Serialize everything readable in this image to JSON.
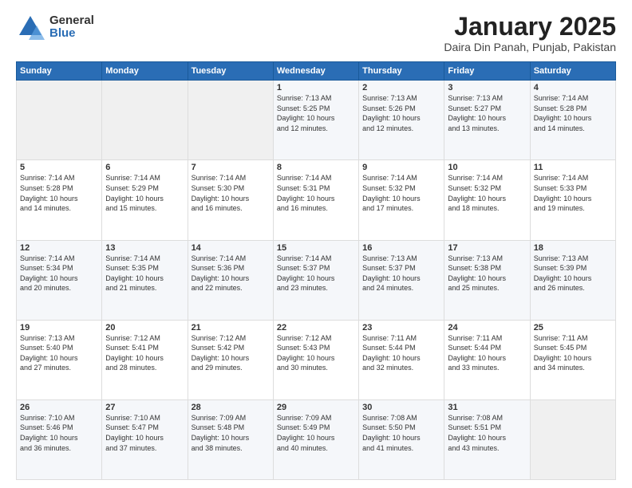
{
  "header": {
    "logo_general": "General",
    "logo_blue": "Blue",
    "month_title": "January 2025",
    "location": "Daira Din Panah, Punjab, Pakistan"
  },
  "weekdays": [
    "Sunday",
    "Monday",
    "Tuesday",
    "Wednesday",
    "Thursday",
    "Friday",
    "Saturday"
  ],
  "weeks": [
    [
      {
        "day": "",
        "info": ""
      },
      {
        "day": "",
        "info": ""
      },
      {
        "day": "",
        "info": ""
      },
      {
        "day": "1",
        "info": "Sunrise: 7:13 AM\nSunset: 5:25 PM\nDaylight: 10 hours\nand 12 minutes."
      },
      {
        "day": "2",
        "info": "Sunrise: 7:13 AM\nSunset: 5:26 PM\nDaylight: 10 hours\nand 12 minutes."
      },
      {
        "day": "3",
        "info": "Sunrise: 7:13 AM\nSunset: 5:27 PM\nDaylight: 10 hours\nand 13 minutes."
      },
      {
        "day": "4",
        "info": "Sunrise: 7:14 AM\nSunset: 5:28 PM\nDaylight: 10 hours\nand 14 minutes."
      }
    ],
    [
      {
        "day": "5",
        "info": "Sunrise: 7:14 AM\nSunset: 5:28 PM\nDaylight: 10 hours\nand 14 minutes."
      },
      {
        "day": "6",
        "info": "Sunrise: 7:14 AM\nSunset: 5:29 PM\nDaylight: 10 hours\nand 15 minutes."
      },
      {
        "day": "7",
        "info": "Sunrise: 7:14 AM\nSunset: 5:30 PM\nDaylight: 10 hours\nand 16 minutes."
      },
      {
        "day": "8",
        "info": "Sunrise: 7:14 AM\nSunset: 5:31 PM\nDaylight: 10 hours\nand 16 minutes."
      },
      {
        "day": "9",
        "info": "Sunrise: 7:14 AM\nSunset: 5:32 PM\nDaylight: 10 hours\nand 17 minutes."
      },
      {
        "day": "10",
        "info": "Sunrise: 7:14 AM\nSunset: 5:32 PM\nDaylight: 10 hours\nand 18 minutes."
      },
      {
        "day": "11",
        "info": "Sunrise: 7:14 AM\nSunset: 5:33 PM\nDaylight: 10 hours\nand 19 minutes."
      }
    ],
    [
      {
        "day": "12",
        "info": "Sunrise: 7:14 AM\nSunset: 5:34 PM\nDaylight: 10 hours\nand 20 minutes."
      },
      {
        "day": "13",
        "info": "Sunrise: 7:14 AM\nSunset: 5:35 PM\nDaylight: 10 hours\nand 21 minutes."
      },
      {
        "day": "14",
        "info": "Sunrise: 7:14 AM\nSunset: 5:36 PM\nDaylight: 10 hours\nand 22 minutes."
      },
      {
        "day": "15",
        "info": "Sunrise: 7:14 AM\nSunset: 5:37 PM\nDaylight: 10 hours\nand 23 minutes."
      },
      {
        "day": "16",
        "info": "Sunrise: 7:13 AM\nSunset: 5:37 PM\nDaylight: 10 hours\nand 24 minutes."
      },
      {
        "day": "17",
        "info": "Sunrise: 7:13 AM\nSunset: 5:38 PM\nDaylight: 10 hours\nand 25 minutes."
      },
      {
        "day": "18",
        "info": "Sunrise: 7:13 AM\nSunset: 5:39 PM\nDaylight: 10 hours\nand 26 minutes."
      }
    ],
    [
      {
        "day": "19",
        "info": "Sunrise: 7:13 AM\nSunset: 5:40 PM\nDaylight: 10 hours\nand 27 minutes."
      },
      {
        "day": "20",
        "info": "Sunrise: 7:12 AM\nSunset: 5:41 PM\nDaylight: 10 hours\nand 28 minutes."
      },
      {
        "day": "21",
        "info": "Sunrise: 7:12 AM\nSunset: 5:42 PM\nDaylight: 10 hours\nand 29 minutes."
      },
      {
        "day": "22",
        "info": "Sunrise: 7:12 AM\nSunset: 5:43 PM\nDaylight: 10 hours\nand 30 minutes."
      },
      {
        "day": "23",
        "info": "Sunrise: 7:11 AM\nSunset: 5:44 PM\nDaylight: 10 hours\nand 32 minutes."
      },
      {
        "day": "24",
        "info": "Sunrise: 7:11 AM\nSunset: 5:44 PM\nDaylight: 10 hours\nand 33 minutes."
      },
      {
        "day": "25",
        "info": "Sunrise: 7:11 AM\nSunset: 5:45 PM\nDaylight: 10 hours\nand 34 minutes."
      }
    ],
    [
      {
        "day": "26",
        "info": "Sunrise: 7:10 AM\nSunset: 5:46 PM\nDaylight: 10 hours\nand 36 minutes."
      },
      {
        "day": "27",
        "info": "Sunrise: 7:10 AM\nSunset: 5:47 PM\nDaylight: 10 hours\nand 37 minutes."
      },
      {
        "day": "28",
        "info": "Sunrise: 7:09 AM\nSunset: 5:48 PM\nDaylight: 10 hours\nand 38 minutes."
      },
      {
        "day": "29",
        "info": "Sunrise: 7:09 AM\nSunset: 5:49 PM\nDaylight: 10 hours\nand 40 minutes."
      },
      {
        "day": "30",
        "info": "Sunrise: 7:08 AM\nSunset: 5:50 PM\nDaylight: 10 hours\nand 41 minutes."
      },
      {
        "day": "31",
        "info": "Sunrise: 7:08 AM\nSunset: 5:51 PM\nDaylight: 10 hours\nand 43 minutes."
      },
      {
        "day": "",
        "info": ""
      }
    ]
  ]
}
